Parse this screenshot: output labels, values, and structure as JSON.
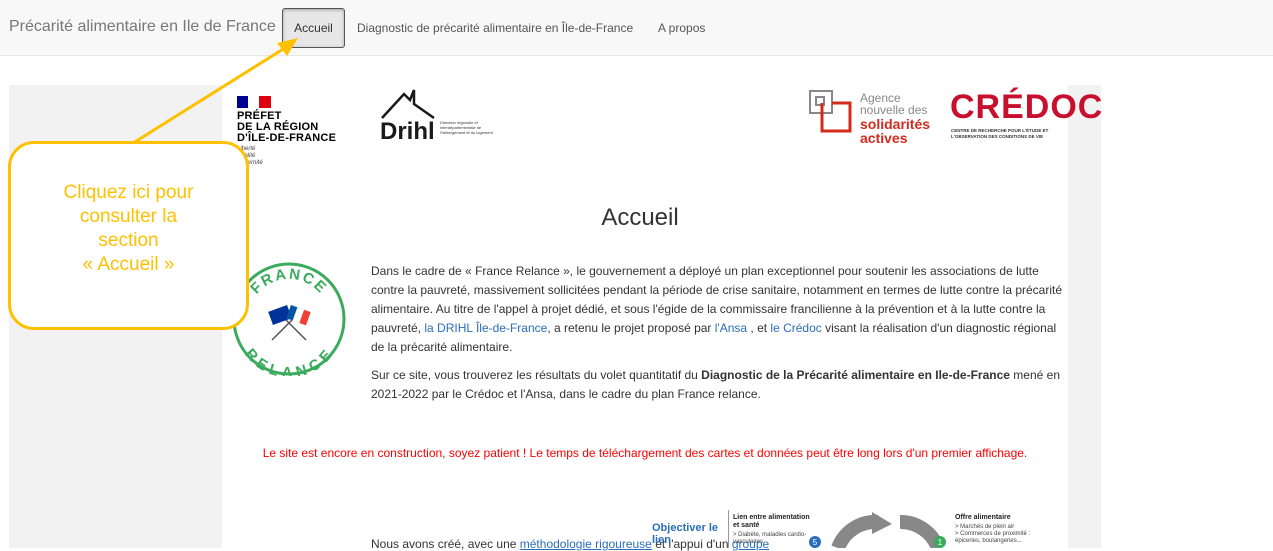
{
  "navbar": {
    "brand": "Précarité alimentaire en Ile de France",
    "items": [
      {
        "label": "Accueil",
        "active": true
      },
      {
        "label": "Diagnostic de précarité alimentaire en Île-de-France",
        "active": false
      },
      {
        "label": "A propos",
        "active": false
      }
    ]
  },
  "logos": {
    "prefet_lines": [
      "PRÉFET",
      "DE LA RÉGION",
      "D'ÎLE-DE-FRANCE"
    ],
    "prefet_motto": [
      "Liberté",
      "Égalité",
      "Fraternité"
    ],
    "drihl_name": "Drihl",
    "drihl_sub": "Direction régionale et interdépartementale de l'hébergement et du logement",
    "ansa_lines": [
      "Agence",
      "nouvelle des"
    ],
    "ansa_bold": [
      "solidarités",
      "actives"
    ],
    "credoc_name": "CRÉDOC",
    "credoc_sub": [
      "CENTRE DE RECHERCHE POUR L'ÉTUDE ET",
      "L'OBSERVATION DES CONDITIONS DE VIE"
    ],
    "relance_top": "FRANCE",
    "relance_bottom": "RELANCE"
  },
  "page": {
    "title": "Accueil",
    "para1": {
      "t1": "Dans le cadre de « France Relance », le gouvernement a déployé un plan exceptionnel pour soutenir les associations de lutte contre la pauvreté, massivement sollicitées pendant la période de crise sanitaire, notamment en termes de lutte contre la précarité alimentaire. Au titre de l'appel à projet dédié, et sous l'égide de la commissaire francilienne à la prévention et à la lutte contre la pauvreté, ",
      "link1": "la DRIHL Île-de-France",
      "t2": ", a retenu le projet proposé par ",
      "link2": "l'Ansa",
      "t3": " , et ",
      "link3": "le Crédoc",
      "t4": " visant la réalisation d'un diagnostic régional de la précarité alimentaire."
    },
    "para2": {
      "t1": "Sur ce site, vous trouverez les résultats du volet quantitatif du ",
      "bold": "Diagnostic de la Précarité alimentaire en Ile-de-France",
      "t2": " mené en 2021-2022 par le Crédoc et l'Ansa, dans le cadre du plan France relance."
    },
    "warning": "Le site est encore en construction, soyez patient ! Le temps de téléchargement des cartes et données peut être long lors d'un premier affichage.",
    "bottom": {
      "t1": "Nous avons créé, avec une ",
      "link1": "méthodologie rigoureuse",
      "t2": " et l'appui d'un ",
      "link2": "groupe"
    },
    "infographic": {
      "objective": [
        "Objectiver le",
        "lien"
      ],
      "lien_head": [
        "Lien entre alimentation",
        "et santé"
      ],
      "lien_items": [
        "> Diabète, maladies cardio-",
        "  vasculaires"
      ],
      "offre_head": "Offre alimentaire",
      "offre_items": [
        "> Marchés de plein air",
        "> Commerces de proximité :",
        "  épiceries, boulangeries..."
      ],
      "num_left": "5",
      "num_right": "1"
    }
  },
  "callout": {
    "lines": [
      "Cliquez ici pour",
      "consulter la",
      "section",
      "« Accueil »"
    ]
  },
  "colors": {
    "callout": "#ffc000",
    "warning": "#ff0000",
    "link": "#2a6ebb",
    "credoc": "#c8102e",
    "ansa": "#d42a1e"
  }
}
